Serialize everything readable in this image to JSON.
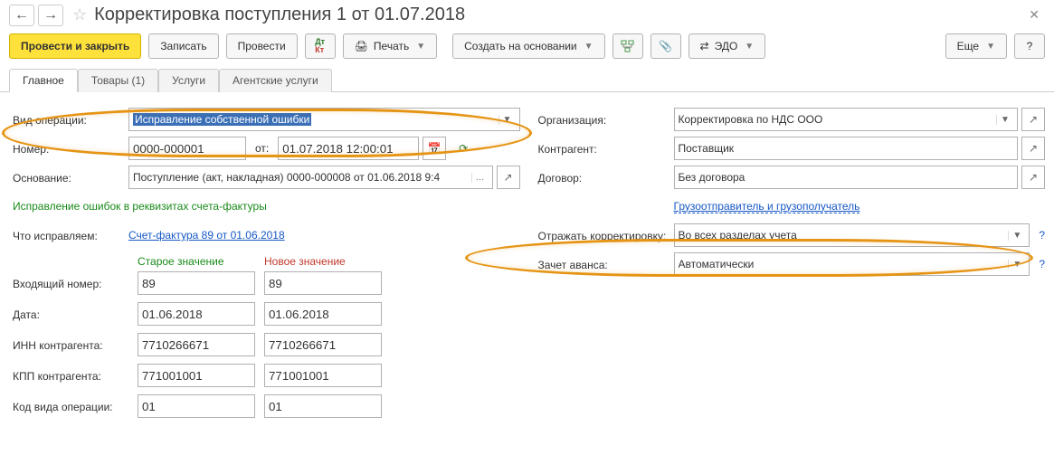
{
  "header": {
    "title": "Корректировка поступления 1 от 01.07.2018"
  },
  "toolbar": {
    "post_and_close": "Провести и закрыть",
    "save": "Записать",
    "post": "Провести",
    "print": "Печать",
    "create_based": "Создать на основании",
    "edo": "ЭДО",
    "more": "Еще",
    "help": "?"
  },
  "tabs": {
    "main": "Главное",
    "goods": "Товары (1)",
    "services": "Услуги",
    "agent": "Агентские услуги"
  },
  "left": {
    "op_type": {
      "label": "Вид операции:",
      "value": "Исправление собственной ошибки"
    },
    "number": {
      "label": "Номер:",
      "value": "0000-000001",
      "from_label": "от:",
      "date": "01.07.2018 12:00:01"
    },
    "basis": {
      "label": "Основание:",
      "value": "Поступление (акт, накладная) 0000-000008 от 01.06.2018 9:4"
    },
    "green_hint": "Исправление ошибок в реквизитах счета-фактуры",
    "fix_what": {
      "label": "Что исправляем:",
      "link": "Счет-фактура 89 от 01.06.2018"
    },
    "compare": {
      "old": "Старое значение",
      "new": "Новое значение",
      "rows": [
        {
          "label": "Входящий номер:",
          "old": "89",
          "new": "89"
        },
        {
          "label": "Дата:",
          "old": "01.06.2018",
          "new": "01.06.2018"
        },
        {
          "label": "ИНН контрагента:",
          "old": "7710266671",
          "new": "7710266671"
        },
        {
          "label": "КПП контрагента:",
          "old": "771001001",
          "new": "771001001"
        },
        {
          "label": "Код вида операции:",
          "old": "01",
          "new": "01"
        }
      ]
    }
  },
  "right": {
    "org": {
      "label": "Организация:",
      "value": "Корректировка по НДС ООО"
    },
    "contr": {
      "label": "Контрагент:",
      "value": "Поставщик"
    },
    "dog": {
      "label": "Договор:",
      "value": "Без договора"
    },
    "shipper_link": "Грузоотправитель и грузополучатель",
    "reflect": {
      "label": "Отражать корректировку:",
      "value": "Во всех разделах учета"
    },
    "advance": {
      "label": "Зачет аванса:",
      "value": "Автоматически"
    },
    "help": "?"
  }
}
